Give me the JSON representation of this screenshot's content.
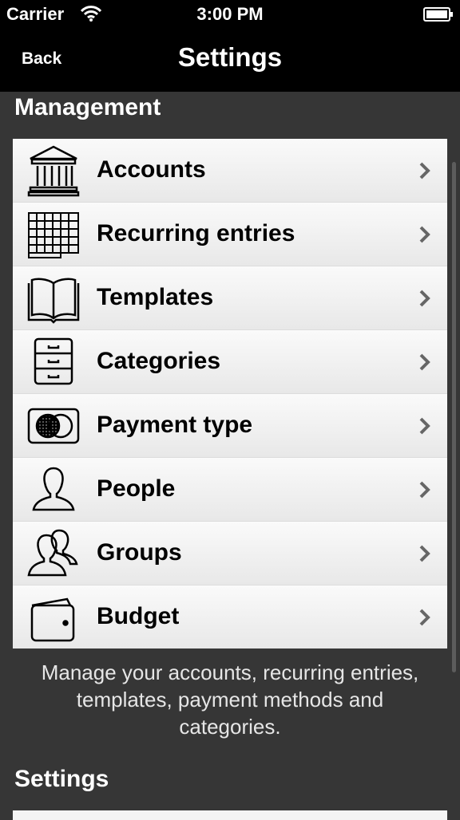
{
  "status": {
    "carrier": "Carrier",
    "time": "3:00 PM"
  },
  "nav": {
    "back_label": "Back",
    "title": "Settings"
  },
  "sections": {
    "management": {
      "title": "Management",
      "items": [
        {
          "label": "Accounts",
          "icon": "bank-icon"
        },
        {
          "label": "Recurring entries",
          "icon": "calendar-grid-icon"
        },
        {
          "label": "Templates",
          "icon": "book-icon"
        },
        {
          "label": "Categories",
          "icon": "drawer-cabinet-icon"
        },
        {
          "label": "Payment type",
          "icon": "credit-card-icon"
        },
        {
          "label": "People",
          "icon": "person-icon"
        },
        {
          "label": "Groups",
          "icon": "group-icon"
        },
        {
          "label": "Budget",
          "icon": "wallet-icon"
        }
      ],
      "footer": "Manage your accounts, recurring entries, templates, payment methods and categories."
    },
    "settings": {
      "title": "Settings"
    }
  }
}
